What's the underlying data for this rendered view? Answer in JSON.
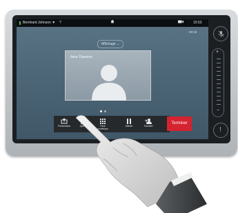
{
  "status_bar": {
    "user": "Bernhard Johnson ▼",
    "help": "?",
    "time": "15:53"
  },
  "call_timer": "00:18",
  "layout_button": "Affichage ⌄",
  "participant": {
    "name": "Jane Dawson"
  },
  "pager": {
    "page": 1,
    "total": 2
  },
  "toolbar": {
    "present": "Présentation",
    "add": "Ajouter",
    "keypad_line1": "Pavé",
    "keypad_line2": "numérique",
    "hold": "Attente",
    "transfer": "Transfert",
    "end": "Terminer"
  },
  "colors": {
    "end_button": "#d5232f",
    "status_green": "#5fbf3f"
  }
}
